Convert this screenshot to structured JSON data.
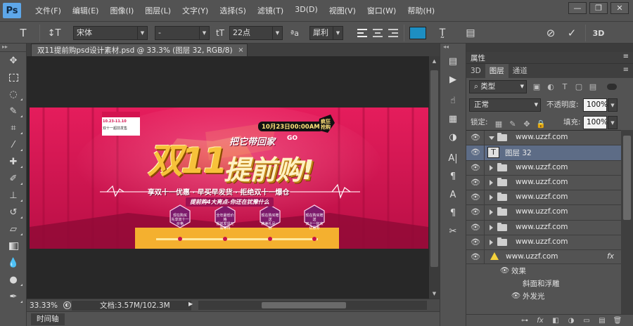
{
  "app": {
    "logo": "Ps"
  },
  "menus": [
    "文件(F)",
    "编辑(E)",
    "图像(I)",
    "图层(L)",
    "文字(Y)",
    "选择(S)",
    "滤镜(T)",
    "3D(D)",
    "视图(V)",
    "窗口(W)",
    "帮助(H)"
  ],
  "window_controls": {
    "minimize": "—",
    "restore": "❐",
    "close": "✕"
  },
  "options": {
    "text_tool_icon": "T",
    "orientation_icon": "↕T",
    "font_family": "宋体",
    "font_style": "-",
    "size_icon": "tT",
    "font_size": "22点",
    "aa_icon": "ªa",
    "antialias": "犀利",
    "color_swatch": "#1d8ec2",
    "warp_icon": "T̰",
    "panels_icon": "▤",
    "cancel_icon": "⊘",
    "commit_icon": "✓",
    "three_d_label": "3D"
  },
  "document": {
    "tab_title": "双11提前购psd设计素材.psd @ 33.3% (图层 32, RGB/8)",
    "close_icon": "×",
    "zoom": "33.33%",
    "doc_info": "文档:3.57M/102.3M",
    "timeline_tab": "时间轴"
  },
  "banner": {
    "badge_top": "10月23日00:00AM",
    "badge_side": "疯狂抢购",
    "logo_line1": "10.23-11.10",
    "logo_line2": "双十一超前发售",
    "headline_num": "双11",
    "headline_slogan": "把它带回家",
    "headline_go": "GO",
    "headline_main": "提前购!",
    "tagline": "享双十一优惠 · 早买早发货 · 拒绝双十一爆仓",
    "subtag": "提前购4大亮点-你还在犹豫什么",
    "hex_items": [
      {
        "l1": "现在购买",
        "l2": "先享双十一价格"
      },
      {
        "l1": "全年最低价格",
        "l2": "提前发货无需等待"
      },
      {
        "l1": "现在购买赠送",
        "l2": "精美礼品一份"
      },
      {
        "l1": "现在购买赠送",
        "l2": "双十一狂欢优惠券"
      }
    ]
  },
  "panel": {
    "title": "属性",
    "tabs": [
      "3D",
      "图层",
      "通道"
    ],
    "filter_kind": "类型",
    "blend_mode": "正常",
    "opacity_label": "不透明度:",
    "opacity_value": "100%",
    "lock_label": "锁定:",
    "fill_label": "填充:",
    "fill_value": "100%",
    "layers": [
      {
        "name": "www.uzzf.com",
        "type": "group",
        "open": true
      },
      {
        "name": "图层 32",
        "type": "text",
        "selected": true
      },
      {
        "name": "www.uzzf.com",
        "type": "group"
      },
      {
        "name": "www.uzzf.com",
        "type": "group"
      },
      {
        "name": "www.uzzf.com",
        "type": "group"
      },
      {
        "name": "www.uzzf.com",
        "type": "group"
      },
      {
        "name": "www.uzzf.com",
        "type": "group"
      },
      {
        "name": "www.uzzf.com",
        "type": "group"
      }
    ],
    "fx_layer": {
      "name": "www.uzzf.com",
      "fx": "fx"
    },
    "effects_label": "效果",
    "effect_items": [
      "斜面和浮雕",
      "外发光"
    ],
    "bottom_icons": [
      "link-icon",
      "fx-icon",
      "mask-icon",
      "adjustment-icon",
      "group-icon",
      "new-layer-icon",
      "trash-icon"
    ],
    "bottom_glyphs": [
      "⊶",
      "fx",
      "◧",
      "◑",
      "▭",
      "▤",
      "🗑"
    ]
  },
  "colors": {
    "accent": "#5ea7e9",
    "selection": "#5d6c86",
    "banner_bg": "#d3134f",
    "gold": "#f7c23a"
  }
}
